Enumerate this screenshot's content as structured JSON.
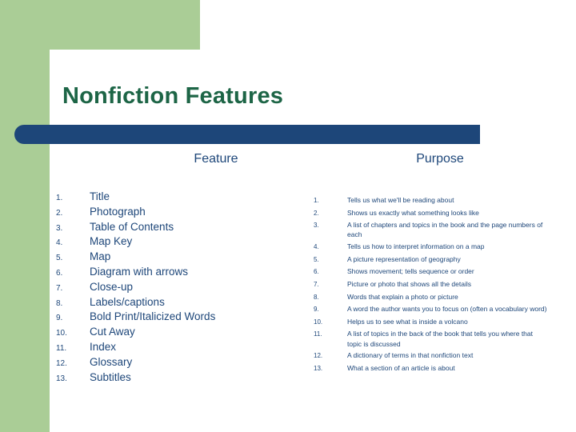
{
  "slide": {
    "title": "Nonfiction Features",
    "headers": {
      "feature": "Feature",
      "purpose": "Purpose"
    },
    "features": [
      {
        "num": "1.",
        "label": "Title"
      },
      {
        "num": "2.",
        "label": "Photograph"
      },
      {
        "num": "3.",
        "label": "Table of Contents"
      },
      {
        "num": "4.",
        "label": "Map Key"
      },
      {
        "num": "5.",
        "label": "Map"
      },
      {
        "num": "6.",
        "label": "Diagram with arrows"
      },
      {
        "num": "7.",
        "label": "Close-up"
      },
      {
        "num": "8.",
        "label": "Labels/captions"
      },
      {
        "num": "9.",
        "label": "Bold Print/Italicized Words"
      },
      {
        "num": "10.",
        "label": "Cut Away"
      },
      {
        "num": "11.",
        "label": "Index"
      },
      {
        "num": "12.",
        "label": "Glossary"
      },
      {
        "num": "13.",
        "label": "Subtitles"
      }
    ],
    "purposes": [
      {
        "num": "1.",
        "label": "Tells us what we'll be reading about"
      },
      {
        "num": "2.",
        "label": "Shows us exactly what something looks like"
      },
      {
        "num": "3.",
        "label": "A list of chapters and topics in the book and the page numbers of each"
      },
      {
        "num": "4.",
        "label": "Tells us how to interpret information on a map"
      },
      {
        "num": "5.",
        "label": "A picture representation of geography"
      },
      {
        "num": "6.",
        "label": "Shows movement; tells sequence or order"
      },
      {
        "num": "7.",
        "label": "Picture or photo that shows all the details"
      },
      {
        "num": "8.",
        "label": "Words that explain a photo or picture"
      },
      {
        "num": "9.",
        "label": "A word the author wants you to focus on (often a vocabulary word)"
      },
      {
        "num": "10.",
        "label": "Helps us to see what is inside a volcano"
      },
      {
        "num": "11.",
        "label": "A list of topics in the back of the book that tells you where that topic is discussed"
      },
      {
        "num": "12.",
        "label": "A dictionary of terms in that nonfiction text"
      },
      {
        "num": "13.",
        "label": "What a section of an article is about"
      }
    ],
    "colors": {
      "green_accent": "#aacd96",
      "title_green": "#1d6546",
      "navy": "#1d4679"
    }
  }
}
